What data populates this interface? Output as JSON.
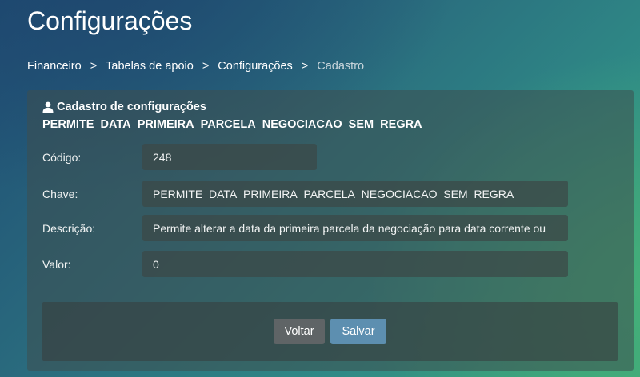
{
  "page": {
    "title": "Configurações"
  },
  "breadcrumb": [
    "Financeiro",
    "Tabelas de apoio",
    "Configurações",
    "Cadastro"
  ],
  "breadcrumb_separator": ">",
  "card": {
    "title": "Cadastro de configurações",
    "subtitle": "PERMITE_DATA_PRIMEIRA_PARCELA_NEGOCIACAO_SEM_REGRA",
    "icon": "user-icon"
  },
  "form": {
    "codigo": {
      "label": "Código:",
      "value": "248"
    },
    "chave": {
      "label": "Chave:",
      "value": "PERMITE_DATA_PRIMEIRA_PARCELA_NEGOCIACAO_SEM_REGRA"
    },
    "descricao": {
      "label": "Descrição:",
      "value": "Permite alterar a data da primeira parcela da negociação para data corrente ou"
    },
    "valor": {
      "label": "Valor:",
      "value": "0"
    }
  },
  "actions": {
    "back_label": "Voltar",
    "save_label": "Salvar"
  },
  "colors": {
    "save_button": "#5d8fb0",
    "back_button": "#5f6466"
  }
}
